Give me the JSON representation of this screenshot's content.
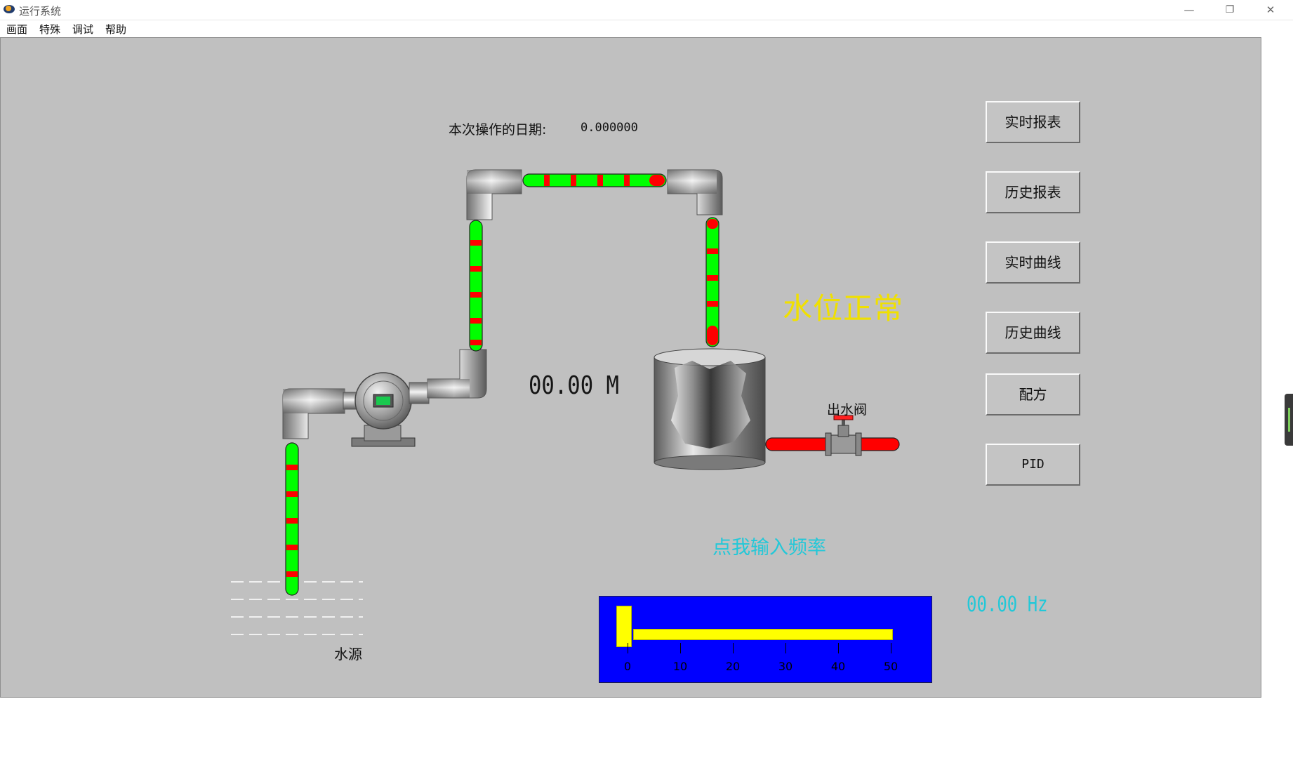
{
  "window": {
    "title": "运行系统",
    "controls": {
      "minimize": "—",
      "restore": "❐",
      "close": "✕"
    }
  },
  "menu": [
    "画面",
    "特殊",
    "调试",
    "帮助"
  ],
  "date": {
    "label": "本次操作的日期:",
    "value": "0.000000"
  },
  "buttons": [
    "实时报表",
    "历史报表",
    "实时曲线",
    "历史曲线",
    "配方",
    "PID"
  ],
  "status": {
    "text": "水位正常",
    "color": "#f0e000"
  },
  "level": {
    "readout": "00.00  M"
  },
  "valve": {
    "label": "出水阀"
  },
  "source": {
    "label": "水源"
  },
  "frequency": {
    "prompt": "点我输入频率",
    "readout": "00.00  Hz",
    "slider_value": 0,
    "slider_min": 0,
    "slider_max": 50,
    "ticks": [
      "0",
      "10",
      "20",
      "30",
      "40",
      "50"
    ]
  },
  "colors": {
    "flow_green": "#00ff00",
    "flow_red": "#ff0000",
    "panel_bg": "#c0c0c0",
    "slider_panel": "#0000ff",
    "slider": "#ffff00",
    "text_cyan": "#22c8d8"
  }
}
